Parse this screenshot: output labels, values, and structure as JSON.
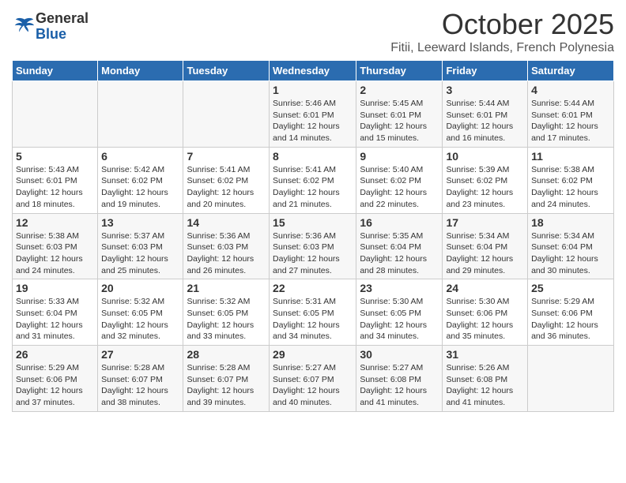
{
  "header": {
    "logo_general": "General",
    "logo_blue": "Blue",
    "month": "October 2025",
    "location": "Fitii, Leeward Islands, French Polynesia"
  },
  "weekdays": [
    "Sunday",
    "Monday",
    "Tuesday",
    "Wednesday",
    "Thursday",
    "Friday",
    "Saturday"
  ],
  "weeks": [
    [
      {
        "date": "",
        "info": ""
      },
      {
        "date": "",
        "info": ""
      },
      {
        "date": "",
        "info": ""
      },
      {
        "date": "1",
        "info": "Sunrise: 5:46 AM\nSunset: 6:01 PM\nDaylight: 12 hours\nand 14 minutes."
      },
      {
        "date": "2",
        "info": "Sunrise: 5:45 AM\nSunset: 6:01 PM\nDaylight: 12 hours\nand 15 minutes."
      },
      {
        "date": "3",
        "info": "Sunrise: 5:44 AM\nSunset: 6:01 PM\nDaylight: 12 hours\nand 16 minutes."
      },
      {
        "date": "4",
        "info": "Sunrise: 5:44 AM\nSunset: 6:01 PM\nDaylight: 12 hours\nand 17 minutes."
      }
    ],
    [
      {
        "date": "5",
        "info": "Sunrise: 5:43 AM\nSunset: 6:01 PM\nDaylight: 12 hours\nand 18 minutes."
      },
      {
        "date": "6",
        "info": "Sunrise: 5:42 AM\nSunset: 6:02 PM\nDaylight: 12 hours\nand 19 minutes."
      },
      {
        "date": "7",
        "info": "Sunrise: 5:41 AM\nSunset: 6:02 PM\nDaylight: 12 hours\nand 20 minutes."
      },
      {
        "date": "8",
        "info": "Sunrise: 5:41 AM\nSunset: 6:02 PM\nDaylight: 12 hours\nand 21 minutes."
      },
      {
        "date": "9",
        "info": "Sunrise: 5:40 AM\nSunset: 6:02 PM\nDaylight: 12 hours\nand 22 minutes."
      },
      {
        "date": "10",
        "info": "Sunrise: 5:39 AM\nSunset: 6:02 PM\nDaylight: 12 hours\nand 23 minutes."
      },
      {
        "date": "11",
        "info": "Sunrise: 5:38 AM\nSunset: 6:02 PM\nDaylight: 12 hours\nand 24 minutes."
      }
    ],
    [
      {
        "date": "12",
        "info": "Sunrise: 5:38 AM\nSunset: 6:03 PM\nDaylight: 12 hours\nand 24 minutes."
      },
      {
        "date": "13",
        "info": "Sunrise: 5:37 AM\nSunset: 6:03 PM\nDaylight: 12 hours\nand 25 minutes."
      },
      {
        "date": "14",
        "info": "Sunrise: 5:36 AM\nSunset: 6:03 PM\nDaylight: 12 hours\nand 26 minutes."
      },
      {
        "date": "15",
        "info": "Sunrise: 5:36 AM\nSunset: 6:03 PM\nDaylight: 12 hours\nand 27 minutes."
      },
      {
        "date": "16",
        "info": "Sunrise: 5:35 AM\nSunset: 6:04 PM\nDaylight: 12 hours\nand 28 minutes."
      },
      {
        "date": "17",
        "info": "Sunrise: 5:34 AM\nSunset: 6:04 PM\nDaylight: 12 hours\nand 29 minutes."
      },
      {
        "date": "18",
        "info": "Sunrise: 5:34 AM\nSunset: 6:04 PM\nDaylight: 12 hours\nand 30 minutes."
      }
    ],
    [
      {
        "date": "19",
        "info": "Sunrise: 5:33 AM\nSunset: 6:04 PM\nDaylight: 12 hours\nand 31 minutes."
      },
      {
        "date": "20",
        "info": "Sunrise: 5:32 AM\nSunset: 6:05 PM\nDaylight: 12 hours\nand 32 minutes."
      },
      {
        "date": "21",
        "info": "Sunrise: 5:32 AM\nSunset: 6:05 PM\nDaylight: 12 hours\nand 33 minutes."
      },
      {
        "date": "22",
        "info": "Sunrise: 5:31 AM\nSunset: 6:05 PM\nDaylight: 12 hours\nand 34 minutes."
      },
      {
        "date": "23",
        "info": "Sunrise: 5:30 AM\nSunset: 6:05 PM\nDaylight: 12 hours\nand 34 minutes."
      },
      {
        "date": "24",
        "info": "Sunrise: 5:30 AM\nSunset: 6:06 PM\nDaylight: 12 hours\nand 35 minutes."
      },
      {
        "date": "25",
        "info": "Sunrise: 5:29 AM\nSunset: 6:06 PM\nDaylight: 12 hours\nand 36 minutes."
      }
    ],
    [
      {
        "date": "26",
        "info": "Sunrise: 5:29 AM\nSunset: 6:06 PM\nDaylight: 12 hours\nand 37 minutes."
      },
      {
        "date": "27",
        "info": "Sunrise: 5:28 AM\nSunset: 6:07 PM\nDaylight: 12 hours\nand 38 minutes."
      },
      {
        "date": "28",
        "info": "Sunrise: 5:28 AM\nSunset: 6:07 PM\nDaylight: 12 hours\nand 39 minutes."
      },
      {
        "date": "29",
        "info": "Sunrise: 5:27 AM\nSunset: 6:07 PM\nDaylight: 12 hours\nand 40 minutes."
      },
      {
        "date": "30",
        "info": "Sunrise: 5:27 AM\nSunset: 6:08 PM\nDaylight: 12 hours\nand 41 minutes."
      },
      {
        "date": "31",
        "info": "Sunrise: 5:26 AM\nSunset: 6:08 PM\nDaylight: 12 hours\nand 41 minutes."
      },
      {
        "date": "",
        "info": ""
      }
    ]
  ]
}
